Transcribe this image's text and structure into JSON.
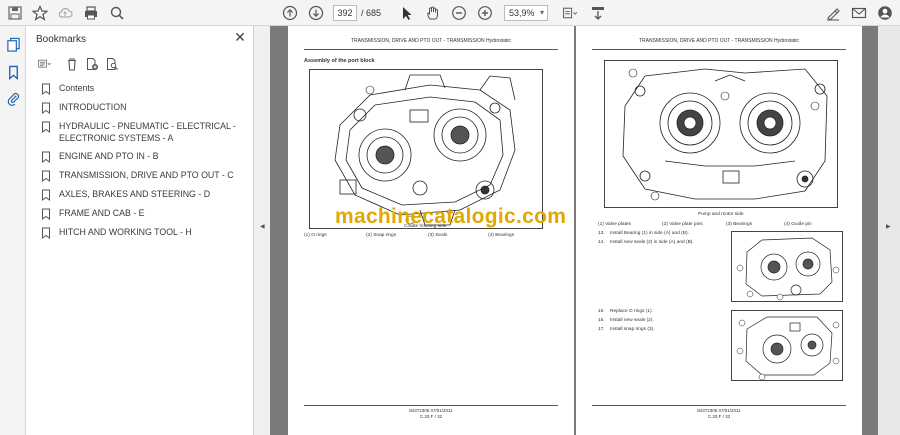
{
  "toolbar": {
    "page_current": "392",
    "page_total": "/ 685",
    "zoom": "53,9%"
  },
  "panel": {
    "title": "Bookmarks",
    "items": [
      {
        "label": "Contents"
      },
      {
        "label": "INTRODUCTION"
      },
      {
        "label": "HYDRAULIC - PNEUMATIC - ELECTRICAL - ELECTRONIC SYSTEMS - A"
      },
      {
        "label": "ENGINE AND PTO IN - B"
      },
      {
        "label": "TRANSMISSION, DRIVE AND PTO OUT - C"
      },
      {
        "label": "AXLES, BRAKES AND STEERING - D"
      },
      {
        "label": "FRAME AND CAB - E"
      },
      {
        "label": "HITCH AND WORKING TOOL - H"
      }
    ]
  },
  "left_page": {
    "header": "TRANSMISSION, DRIVE AND PTO OUT - TRANSMISSION Hydrostatic",
    "section_title": "Assembly of the port block",
    "figure_caption": "Cradle housing side",
    "legend": [
      "(1) O rings",
      "(2) Snap rings",
      "(3) Seals",
      "(4) Bearings"
    ],
    "footer_line1": "84372305 07/01/2011",
    "footer_line2": "C.20.F / 32"
  },
  "right_page": {
    "header": "TRANSMISSION, DRIVE AND PTO OUT - TRANSMISSION Hydrostatic",
    "figure_caption": "Pump and motor side",
    "legend": [
      "(1) Valve plates",
      "(2) Valve plate pins",
      "(3) Bearings",
      "(4) Guide pin"
    ],
    "steps": [
      {
        "num": "13.",
        "text": "Install Bearing (1) in side (A) and (B)."
      },
      {
        "num": "14.",
        "text": "Install new seals (2) in side (A) and (B)."
      },
      {
        "num": "15.",
        "text": "Replace O rings (1)."
      },
      {
        "num": "16.",
        "text": "Install new seals (2)."
      },
      {
        "num": "17.",
        "text": "Install snap rings (3)."
      }
    ],
    "footer_line1": "84372305 07/01/2011",
    "footer_line2": "C.20.F / 33"
  },
  "watermark": "machinecatalogic.com"
}
